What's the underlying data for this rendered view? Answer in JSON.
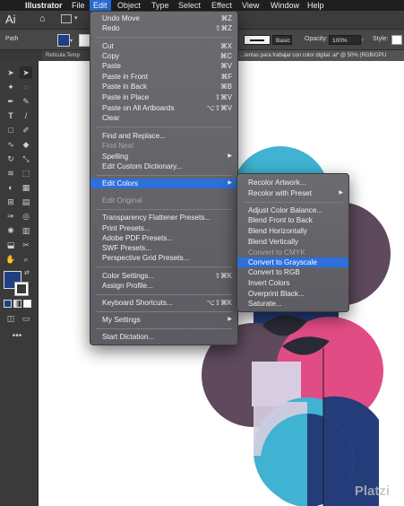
{
  "menubar": {
    "apple": "",
    "items": [
      "Illustrator",
      "File",
      "Edit",
      "Object",
      "Type",
      "Select",
      "Effect",
      "View",
      "Window",
      "Help"
    ]
  },
  "controlbar": {
    "path_label": "Path",
    "stroke_style": "Basic",
    "opacity_label": "Opacity:",
    "opacity_value": "100%",
    "style_label": "Style:"
  },
  "tabs": {
    "tab1": "Reticula Temp",
    "tab2": "...ientas para trabajar con color digital .ai* @ 50% (RGB/GPU"
  },
  "edit_menu": {
    "undo": {
      "label": "Undo Move",
      "shortcut": "⌘Z"
    },
    "redo": {
      "label": "Redo",
      "shortcut": "⇧⌘Z"
    },
    "cut": {
      "label": "Cut",
      "shortcut": "⌘X"
    },
    "copy": {
      "label": "Copy",
      "shortcut": "⌘C"
    },
    "paste": {
      "label": "Paste",
      "shortcut": "⌘V"
    },
    "paste_front": {
      "label": "Paste in Front",
      "shortcut": "⌘F"
    },
    "paste_back": {
      "label": "Paste in Back",
      "shortcut": "⌘B"
    },
    "paste_place": {
      "label": "Paste in Place",
      "shortcut": "⇧⌘V"
    },
    "paste_all": {
      "label": "Paste on All Artboards",
      "shortcut": "⌥⇧⌘V"
    },
    "clear": {
      "label": "Clear"
    },
    "find_replace": {
      "label": "Find and Replace..."
    },
    "find_next": {
      "label": "Find Next"
    },
    "spelling": {
      "label": "Spelling"
    },
    "dictionary": {
      "label": "Edit Custom Dictionary..."
    },
    "edit_colors": {
      "label": "Edit Colors"
    },
    "edit_original": {
      "label": "Edit Original"
    },
    "flattener": {
      "label": "Transparency Flattener Presets..."
    },
    "print_presets": {
      "label": "Print Presets..."
    },
    "pdf_presets": {
      "label": "Adobe PDF Presets..."
    },
    "swf_presets": {
      "label": "SWF Presets..."
    },
    "grid_presets": {
      "label": "Perspective Grid Presets..."
    },
    "color_settings": {
      "label": "Color Settings...",
      "shortcut": "⇧⌘K"
    },
    "assign_profile": {
      "label": "Assign Profile..."
    },
    "keyboard_shortcuts": {
      "label": "Keyboard Shortcuts...",
      "shortcut": "⌥⇧⌘K"
    },
    "my_settings": {
      "label": "My Settings"
    },
    "dictation": {
      "label": "Start Dictation..."
    }
  },
  "edit_colors_menu": {
    "recolor_artwork": "Recolor Artwork...",
    "recolor_preset": "Recolor with Preset",
    "adjust_balance": "Adjust Color Balance...",
    "blend_front_back": "Blend Front to Back",
    "blend_horizontally": "Blend Horizontally",
    "blend_vertically": "Blend Vertically",
    "convert_cmyk": "Convert to CMYK",
    "convert_grayscale": "Convert to Grayscale",
    "convert_rgb": "Convert to RGB",
    "invert_colors": "Invert Colors",
    "overprint_black": "Overprint Black...",
    "saturate": "Saturate..."
  },
  "colors": {
    "menu_highlight": "#2d6fdb",
    "fill_swatch": "#1f3f82",
    "art_cyan": "#3fb3d1",
    "art_pink": "#e24c85",
    "art_plum": "#5e4a5c",
    "art_navy": "#243d7a",
    "art_lilac": "#d8cde0"
  },
  "watermark": "Platzi"
}
